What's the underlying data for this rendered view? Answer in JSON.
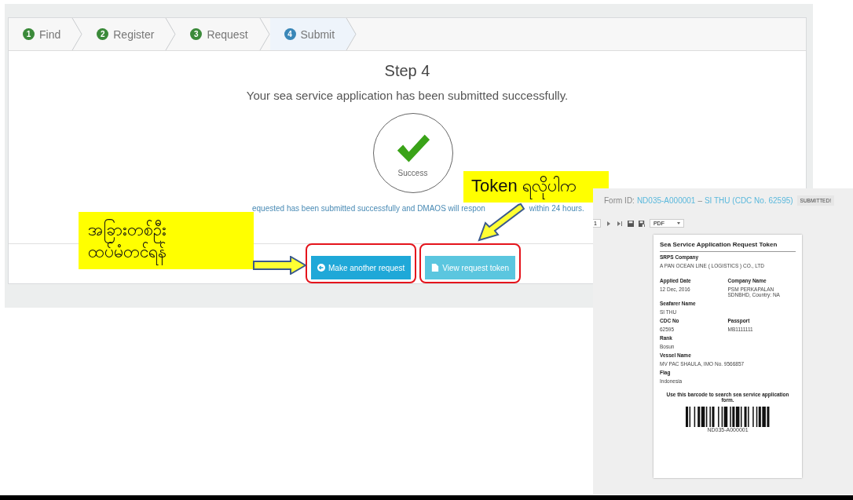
{
  "steps": [
    {
      "number": "1",
      "label": "Find",
      "selected": false
    },
    {
      "number": "2",
      "label": "Register",
      "selected": false
    },
    {
      "number": "3",
      "label": "Request",
      "selected": false
    },
    {
      "number": "4",
      "label": "Submit",
      "selected": true
    }
  ],
  "heading": "Step 4",
  "subheading": "Your sea service application has been submitted successfully.",
  "status": {
    "label": "Success"
  },
  "message": [
    "equested has been submitted successfully and DMAOS will respon",
    "within 24 hours."
  ],
  "buttons": [
    {
      "label": "Make another request",
      "kind": "primary"
    },
    {
      "label": "View request token",
      "kind": "info"
    }
  ],
  "annotations": [
    {
      "lines": [
        "အခြားတစ်ဦး",
        "ထပ်မံတင်ရန်"
      ]
    },
    {
      "lines": [
        "Token ရလိုပါက"
      ]
    }
  ],
  "token_window": {
    "form_id_label": "Form ID:",
    "form_id": "ND035-A000001",
    "separator": "–",
    "seafarer": "SI THU (CDC No. 62595)",
    "badge": "SUBMITTED!",
    "toolbar": {
      "page": "1",
      "format": "PDF"
    },
    "document": {
      "title": "Sea Service Application Request Token",
      "rows": [
        [
          {
            "label": "SRPS Company",
            "value": "A PAN OCEAN LINE ( LOGISTICS ) CO., LTD"
          }
        ],
        [
          {
            "label": "Applied Date",
            "value": "12 Dec, 2016"
          },
          {
            "label": "Company Name",
            "value": "PSM PERKAPALAN SDNBHD, Country: NA"
          }
        ],
        [
          {
            "label": "Seafarer Name",
            "value": "SI THU"
          }
        ],
        [
          {
            "label": "CDC No",
            "value": "62595"
          },
          {
            "label": "Passport",
            "value": "MB1111111"
          }
        ],
        [
          {
            "label": "Rank",
            "value": "Bosun"
          }
        ],
        [
          {
            "label": "Vessel Name",
            "value": "MV PAC SHAULA, IMO No. 9566857"
          }
        ],
        [
          {
            "label": "Flag",
            "value": "Indonesia"
          }
        ]
      ],
      "note": "Use this barcode to search sea service application form.",
      "barcode_text": "ND035-A000001"
    }
  }
}
